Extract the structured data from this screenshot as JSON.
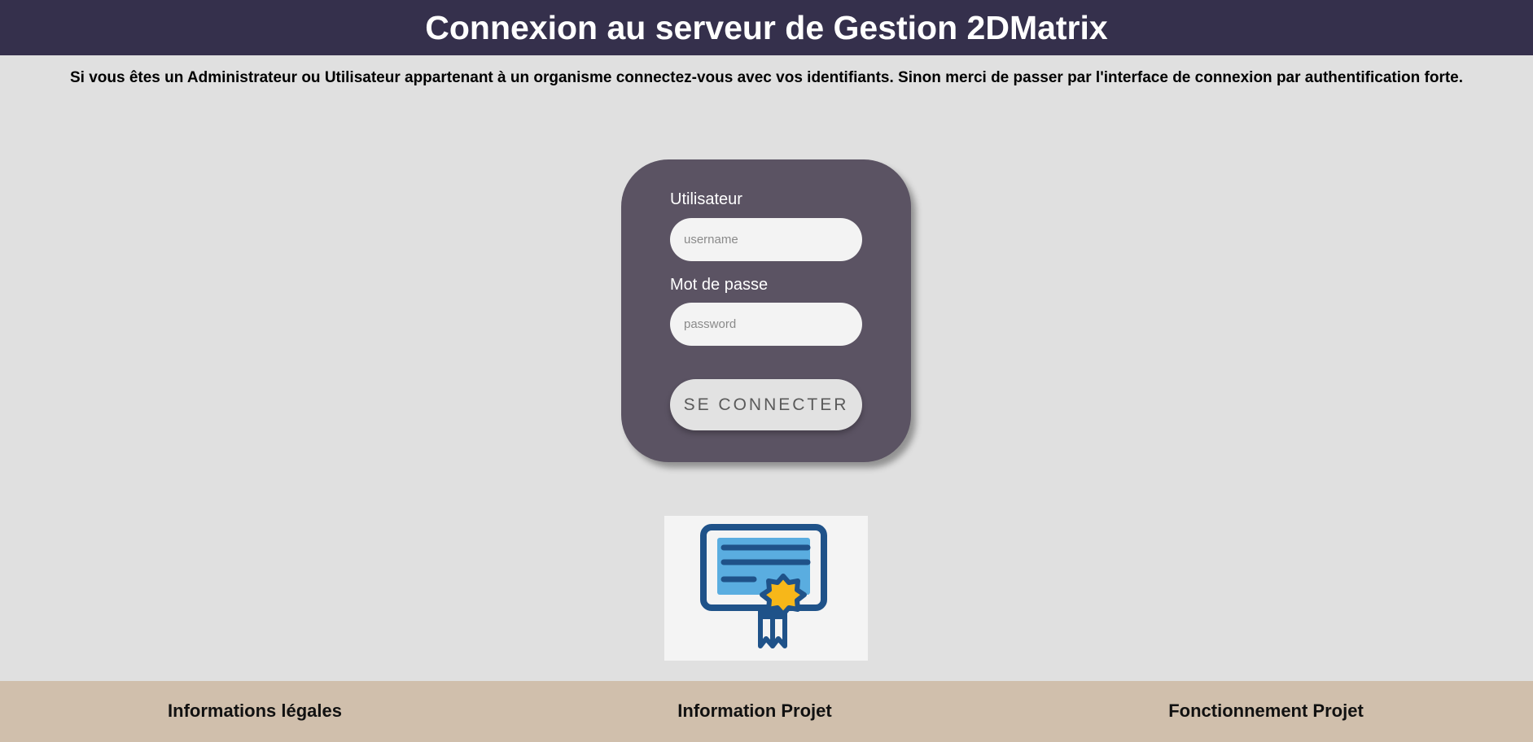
{
  "header": {
    "title": "Connexion au serveur de Gestion 2DMatrix"
  },
  "intro": {
    "text": "Si vous êtes un Administrateur ou Utilisateur appartenant à un organisme connectez-vous avec vos identifiants. Sinon merci de passer par l'interface de connexion par authentification forte."
  },
  "login": {
    "username_label": "Utilisateur",
    "username_placeholder": "username",
    "username_value": "",
    "password_label": "Mot de passe",
    "password_placeholder": "password",
    "password_value": "",
    "submit_label": "SE CONNECTER"
  },
  "certificate_link": {
    "icon": "certificate-icon",
    "colors": {
      "frame": "#1f5289",
      "paper": "#5aade0",
      "seal": "#f7b719",
      "background": "#f4f4f4"
    }
  },
  "footer": {
    "links": [
      {
        "label": "Informations légales"
      },
      {
        "label": "Information Projet"
      },
      {
        "label": "Fonctionnement Projet"
      }
    ]
  },
  "colors": {
    "header_bg": "#35304c",
    "page_bg": "#e0e0e0",
    "card_bg": "#5b5363",
    "footer_bg": "#d0bfac"
  }
}
